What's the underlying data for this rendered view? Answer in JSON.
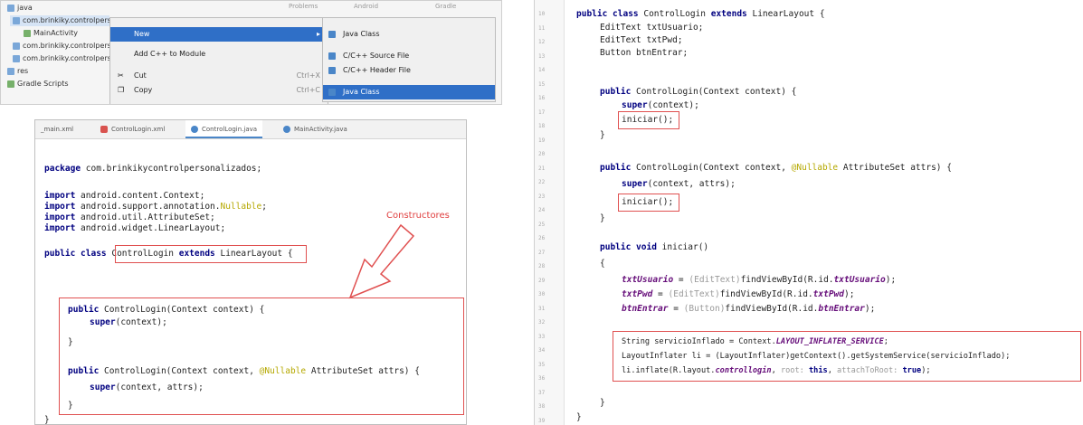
{
  "menu_panel": {
    "header_faint": [
      "Problems",
      "Android",
      "Gradle"
    ],
    "tree": [
      {
        "label": "java"
      },
      {
        "label": "com.brinkiky.controlpersonalizado",
        "selected": true
      },
      {
        "label": "MainActivity"
      },
      {
        "label": "com.brinkiky.controlpersonalizado (androidTest)"
      },
      {
        "label": "com.brinkiky.controlpersonalizado (test)"
      },
      {
        "label": "res"
      },
      {
        "label": "Gradle Scripts"
      }
    ],
    "context_menu": [
      {
        "label": "New",
        "shortcut": "",
        "has_submenu": true,
        "highlighted": true
      },
      {
        "label": "Add C++ to Module",
        "shortcut": "",
        "has_submenu": false,
        "highlighted": false
      },
      {
        "label": "Cut",
        "shortcut": "Ctrl+X",
        "has_submenu": false,
        "highlighted": false
      },
      {
        "label": "Copy",
        "shortcut": "Ctrl+C",
        "has_submenu": false,
        "highlighted": false
      }
    ],
    "submenu": [
      {
        "label": "Java Class",
        "highlighted": false
      },
      {
        "label": "C/C++ Source File",
        "highlighted": false
      },
      {
        "label": "C/C++ Header File",
        "highlighted": false
      },
      {
        "label": "Java Class",
        "highlighted": true
      }
    ]
  },
  "code_left": {
    "tabs": [
      {
        "label": "_main.xml",
        "active": false
      },
      {
        "label": "ControlLogin.xml",
        "active": false
      },
      {
        "label": "ControlLogin.java",
        "active": true
      },
      {
        "label": "MainActivity.java",
        "active": false
      }
    ],
    "annotation_label": "Constructores",
    "lines": {
      "pkg_kw": "package",
      "pkg_name": " com.brinkikycontrolpersonalizados;",
      "imp_kw": "import",
      "imp1": " android.content.Context;",
      "imp2a": " android.support.annotation.",
      "imp2b": "Nullable",
      "imp2c": ";",
      "imp3": " android.util.AttributeSet;",
      "imp4": " android.widget.LinearLayout;",
      "cls_pre": "public class ",
      "cls_name": "ControlLogin ",
      "extends_kw": "extends",
      "cls_parent": " LinearLayout",
      "cls_brace": " {",
      "public_kw": "public",
      "ctor1": " ControlLogin(Context context) {",
      "super_kw": "super",
      "super1": "(context);",
      "close_brace": "}",
      "ctor2a": " ControlLogin(Context context, ",
      "ctor2b": "@Nullable",
      "ctor2c": " AttributeSet attrs) {",
      "super2": "(context, attrs);"
    }
  },
  "code_right": {
    "gutter_numbers": [
      "10",
      "11",
      "12",
      "13",
      "14",
      "15",
      "16",
      "17",
      "18",
      "19",
      "20",
      "21",
      "22",
      "23",
      "24",
      "25",
      "26",
      "27",
      "28",
      "29",
      "30",
      "31",
      "32",
      "33",
      "34",
      "35",
      "36",
      "37",
      "38",
      "39"
    ],
    "lines": {
      "cls_kw": "public class ",
      "cls_name": "ControlLogin ",
      "extends_kw": "extends",
      "cls_rest": " LinearLayout {",
      "f1": "EditText txtUsuario;",
      "f2": "EditText txtPwd;",
      "f3": "Button btnEntrar;",
      "public_kw": "public",
      "ctor1": " ControlLogin(Context context) {",
      "super_kw": "super",
      "super1": "(context);",
      "iniciar_call": "iniciar();",
      "close_brace": "}",
      "ctor2a": " ControlLogin(Context context, ",
      "ctor2b": "@Nullable",
      "ctor2c": " AttributeSet attrs) {",
      "super2": "(context, attrs);",
      "void_kw": " void",
      "iniciar_decl": " iniciar()",
      "open_brace": "{",
      "a1a": "txtUsuario",
      "a1b": " = ",
      "a1c": "(EditText)",
      "a1d": "findViewById(R.id.",
      "a1e": "txtUsuario",
      "a1f": ");",
      "a2a": "txtPwd",
      "a2b": " = ",
      "a2c": "(EditText)",
      "a2d": "findViewById(R.id.",
      "a2e": "txtPwd",
      "a2f": ");",
      "a3a": "btnEntrar",
      "a3b": " = ",
      "a3c": "(Button)",
      "a3d": "findViewById(R.id.",
      "a3e": "btnEntrar",
      "a3f": ");",
      "s1a": "String servicioInflado = Context.",
      "s1b": "LAYOUT_INFLATER_SERVICE",
      "s1c": ";",
      "s2": "LayoutInflater li = (LayoutInflater)getContext().getSystemService(servicioInflado);",
      "s3a": "li.inflate(R.layout.",
      "s3b": "controllogin",
      "s3c": ", ",
      "s3d": "root:",
      "s3e": " this",
      "s3f": ", ",
      "s3g": "attachToRoot:",
      "s3h": " true",
      "s3i": ");"
    }
  }
}
